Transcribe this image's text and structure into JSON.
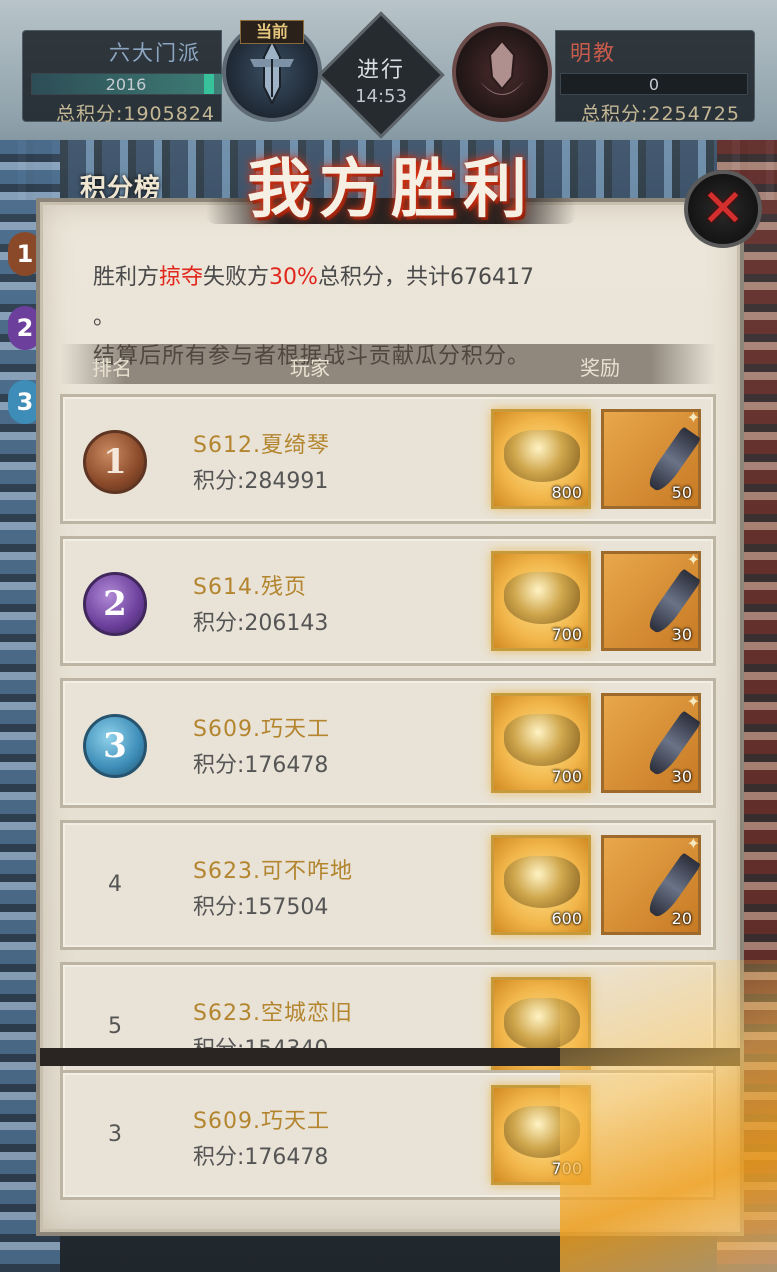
{
  "header": {
    "left_faction": {
      "name": "六大门派",
      "member_count": "2016",
      "total_score": "总积分:1905824",
      "current_tag": "当前"
    },
    "right_faction": {
      "name": "明教",
      "member_count": "0",
      "total_score": "总积分:2254725"
    },
    "status": {
      "label": "进行",
      "time": "14:53"
    },
    "ranking_tab": "积分榜",
    "victory_title": "我方胜利"
  },
  "intro": {
    "line1_prefix": "胜利方",
    "line1_highlight": "掠夺",
    "line1_middle": "失败方",
    "line1_percent": "30%",
    "line1_suffix": "总积分，共计676417",
    "line1_end": "。",
    "line2": "结算后所有参与者根据战斗贡献瓜分积分。"
  },
  "columns": {
    "rank": "排名",
    "player": "玩家",
    "reward": "奖励"
  },
  "side_badges": [
    "1",
    "2",
    "3"
  ],
  "rows": [
    {
      "rank": "1",
      "name": "S612.夏绮琴",
      "score": "积分:284991",
      "gold_qty": "800",
      "weapon_qty": "50"
    },
    {
      "rank": "2",
      "name": "S614.残页",
      "score": "积分:206143",
      "gold_qty": "700",
      "weapon_qty": "30"
    },
    {
      "rank": "3",
      "name": "S609.巧天工",
      "score": "积分:176478",
      "gold_qty": "700",
      "weapon_qty": "30"
    },
    {
      "rank": "4",
      "name": "S623.可不咋地",
      "score": "积分:157504",
      "gold_qty": "600",
      "weapon_qty": "20"
    },
    {
      "rank": "5",
      "name": "S623.空城恋旧",
      "score": "积分:154340",
      "gold_qty": "",
      "weapon_qty": ""
    },
    {
      "rank": "3",
      "name": "S609.巧天工",
      "score": "积分:176478",
      "gold_qty": "700",
      "weapon_qty": ""
    }
  ],
  "colors": {
    "highlight_red": "#e1261c",
    "name_gold": "#b3852f",
    "panel_bg": "#ece6da"
  }
}
